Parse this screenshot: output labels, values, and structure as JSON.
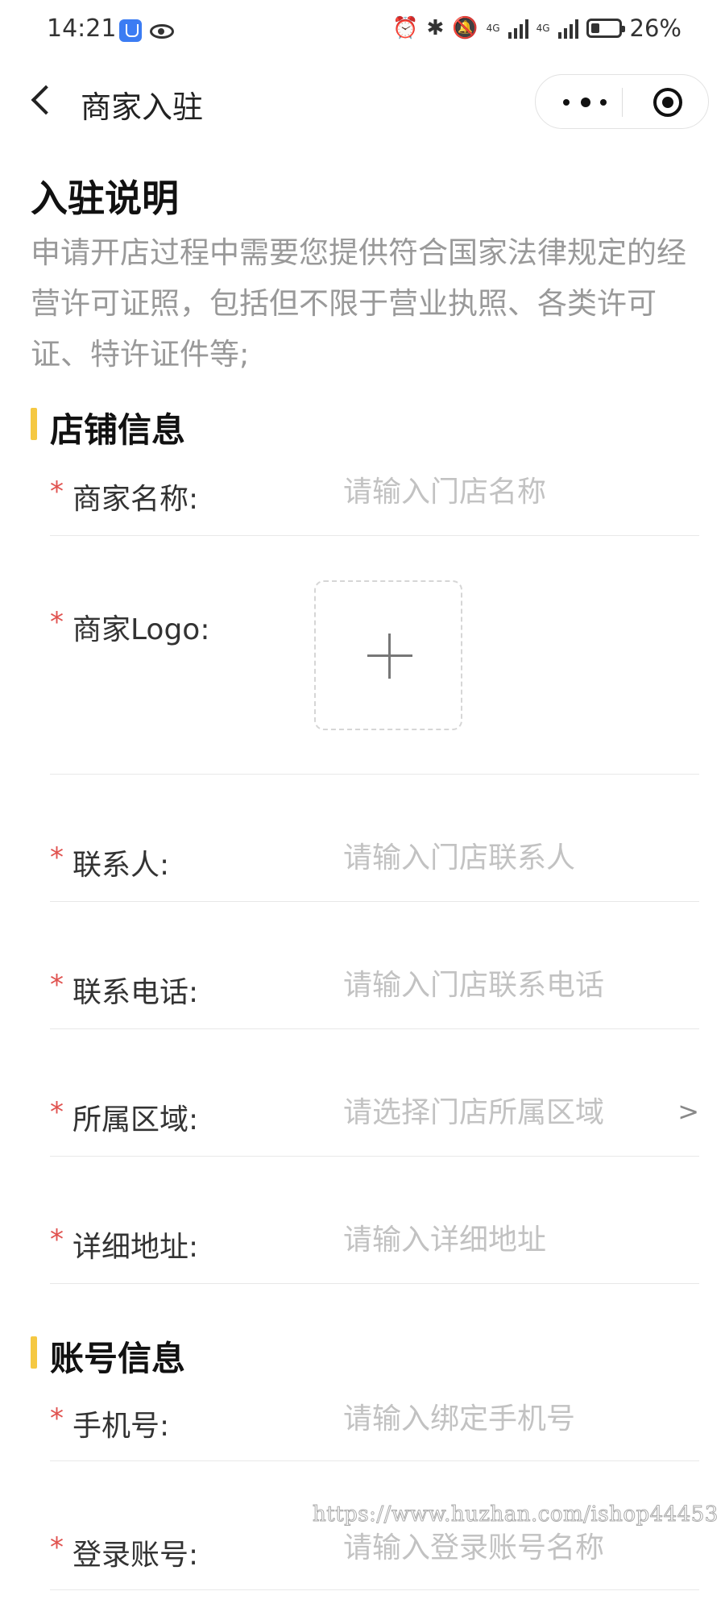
{
  "status_bar": {
    "time": "14:21",
    "network_1": "4G",
    "network_2": "4G",
    "battery_percent": "26%"
  },
  "nav": {
    "title": "商家入驻"
  },
  "intro": {
    "title": "入驻说明",
    "text": "申请开店过程中需要您提供符合国家法律规定的经营许可证照，包括但不限于营业执照、各类许可证、特许证件等;"
  },
  "store_section": {
    "title": "店铺信息",
    "fields": [
      {
        "label": "商家名称:",
        "placeholder": "请输入门店名称"
      },
      {
        "label": "商家Logo:"
      },
      {
        "label": "联系人:",
        "placeholder": "请输入门店联系人"
      },
      {
        "label": "联系电话:",
        "placeholder": "请输入门店联系电话"
      },
      {
        "label": "所属区域:",
        "placeholder": "请选择门店所属区域",
        "chevron": ">"
      },
      {
        "label": "详细地址:",
        "placeholder": "请输入详细地址"
      }
    ]
  },
  "account_section": {
    "title": "账号信息",
    "fields": [
      {
        "label": "手机号:",
        "placeholder": "请输入绑定手机号"
      },
      {
        "label": "登录账号:",
        "placeholder": "请输入登录账号名称"
      }
    ]
  },
  "required_mark": "*",
  "watermark": "https://www.huzhan.com/ishop44453",
  "colors": {
    "accent": "#f5c842",
    "required": "#e0524f",
    "placeholder": "#c2c2c2",
    "intro_text": "#999999"
  }
}
